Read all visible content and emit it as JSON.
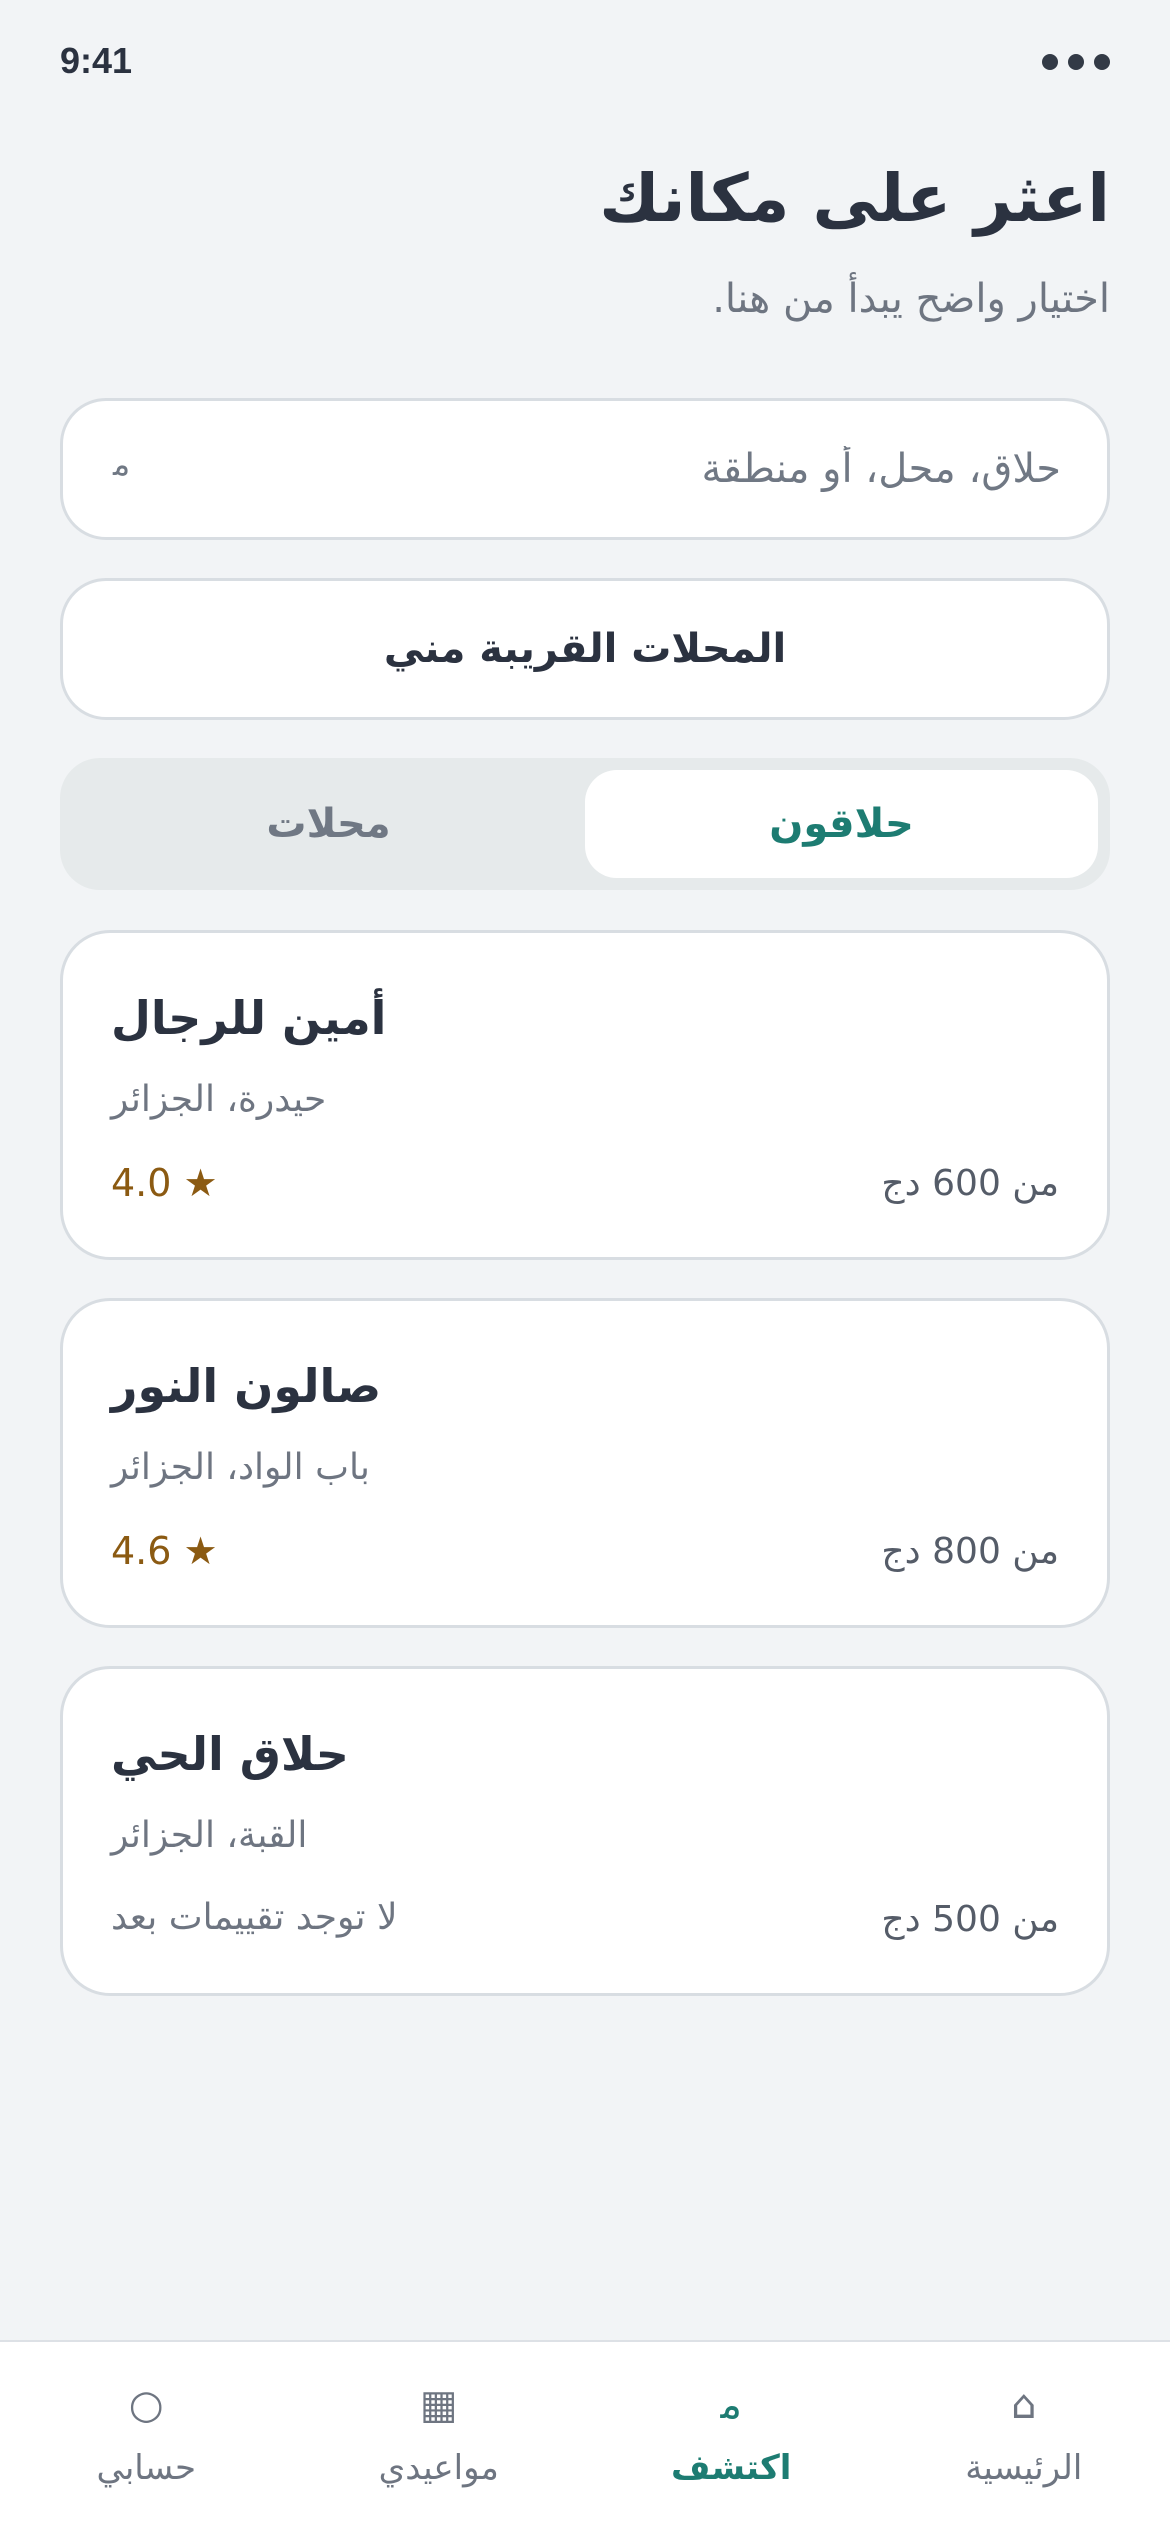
{
  "status_bar": {
    "time": "9:41"
  },
  "header": {
    "title": "اعثر على مكانك",
    "subtitle": "اختيار واضح يبدأ من هنا."
  },
  "search": {
    "value": "",
    "placeholder": "حلاق، محل، أو منطقة",
    "icon": "search-icon",
    "icon_glyph": "ﻣ"
  },
  "nearby_button": {
    "label": "المحلات القريبة مني"
  },
  "tabs": [
    {
      "label": "حلاقون",
      "active": true
    },
    {
      "label": "محلات",
      "active": false
    }
  ],
  "results": [
    {
      "name": "أمين للرجال",
      "location": "حيدرة، الجزائر",
      "rating": "4.0 ★",
      "price": "من 600 دج"
    },
    {
      "name": "صالون النور",
      "location": "باب الواد، الجزائر",
      "rating": "4.6 ★",
      "price": "من 800 دج"
    },
    {
      "name": "حلاق الحي",
      "location": "القبة، الجزائر",
      "rating": "لا توجد تقييمات بعد",
      "price": "من 500 دج"
    }
  ],
  "bottom_nav": [
    {
      "label": "الرئيسية",
      "icon": "home-icon",
      "glyph": "⌂",
      "active": false
    },
    {
      "label": "اكتشف",
      "icon": "search-icon",
      "glyph": "ﻣ",
      "active": true
    },
    {
      "label": "مواعيدي",
      "icon": "calendar-icon",
      "glyph": "▦",
      "active": false
    },
    {
      "label": "حسابي",
      "icon": "profile-icon",
      "glyph": "○",
      "active": false
    }
  ],
  "colors": {
    "accent": "#1d7c72",
    "rating": "#8b5a12",
    "background": "#f2f4f6",
    "card": "#ffffff",
    "border": "#d8dde2"
  }
}
